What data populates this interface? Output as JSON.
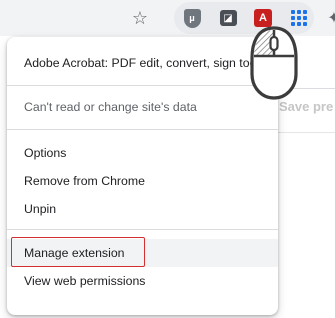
{
  "toolbar": {
    "icons": {
      "bookmark": "star-icon",
      "ublock": "ublock-shield-icon",
      "extension_2": "extension-icon",
      "acrobat": "adobe-acrobat-icon",
      "grid": "grid-extension-icon",
      "extensions_menu": "puzzle-icon"
    }
  },
  "menu": {
    "header_item": "Adobe Acrobat: PDF edit, convert, sign tools",
    "site_data_status": "Can't read or change site's data",
    "options": "Options",
    "remove": "Remove from Chrome",
    "unpin": "Unpin",
    "manage_extension": "Manage extension",
    "view_permissions": "View web permissions"
  },
  "background": {
    "save_button_partial": "Save pre"
  },
  "colors": {
    "highlight_border": "#d32f2f",
    "acrobat_red": "#c8201f",
    "grid_blue": "#1a73e8"
  }
}
